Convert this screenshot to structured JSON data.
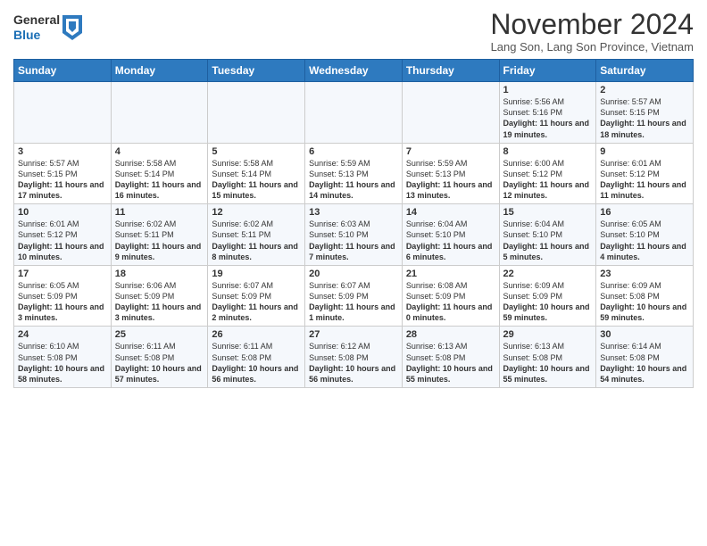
{
  "header": {
    "logo_general": "General",
    "logo_blue": "Blue",
    "month_title": "November 2024",
    "subtitle": "Lang Son, Lang Son Province, Vietnam"
  },
  "weekdays": [
    "Sunday",
    "Monday",
    "Tuesday",
    "Wednesday",
    "Thursday",
    "Friday",
    "Saturday"
  ],
  "weeks": [
    [
      {
        "day": "",
        "info": ""
      },
      {
        "day": "",
        "info": ""
      },
      {
        "day": "",
        "info": ""
      },
      {
        "day": "",
        "info": ""
      },
      {
        "day": "",
        "info": ""
      },
      {
        "day": "1",
        "info": "Sunrise: 5:56 AM\nSunset: 5:16 PM\nDaylight: 11 hours and 19 minutes."
      },
      {
        "day": "2",
        "info": "Sunrise: 5:57 AM\nSunset: 5:15 PM\nDaylight: 11 hours and 18 minutes."
      }
    ],
    [
      {
        "day": "3",
        "info": "Sunrise: 5:57 AM\nSunset: 5:15 PM\nDaylight: 11 hours and 17 minutes."
      },
      {
        "day": "4",
        "info": "Sunrise: 5:58 AM\nSunset: 5:14 PM\nDaylight: 11 hours and 16 minutes."
      },
      {
        "day": "5",
        "info": "Sunrise: 5:58 AM\nSunset: 5:14 PM\nDaylight: 11 hours and 15 minutes."
      },
      {
        "day": "6",
        "info": "Sunrise: 5:59 AM\nSunset: 5:13 PM\nDaylight: 11 hours and 14 minutes."
      },
      {
        "day": "7",
        "info": "Sunrise: 5:59 AM\nSunset: 5:13 PM\nDaylight: 11 hours and 13 minutes."
      },
      {
        "day": "8",
        "info": "Sunrise: 6:00 AM\nSunset: 5:12 PM\nDaylight: 11 hours and 12 minutes."
      },
      {
        "day": "9",
        "info": "Sunrise: 6:01 AM\nSunset: 5:12 PM\nDaylight: 11 hours and 11 minutes."
      }
    ],
    [
      {
        "day": "10",
        "info": "Sunrise: 6:01 AM\nSunset: 5:12 PM\nDaylight: 11 hours and 10 minutes."
      },
      {
        "day": "11",
        "info": "Sunrise: 6:02 AM\nSunset: 5:11 PM\nDaylight: 11 hours and 9 minutes."
      },
      {
        "day": "12",
        "info": "Sunrise: 6:02 AM\nSunset: 5:11 PM\nDaylight: 11 hours and 8 minutes."
      },
      {
        "day": "13",
        "info": "Sunrise: 6:03 AM\nSunset: 5:10 PM\nDaylight: 11 hours and 7 minutes."
      },
      {
        "day": "14",
        "info": "Sunrise: 6:04 AM\nSunset: 5:10 PM\nDaylight: 11 hours and 6 minutes."
      },
      {
        "day": "15",
        "info": "Sunrise: 6:04 AM\nSunset: 5:10 PM\nDaylight: 11 hours and 5 minutes."
      },
      {
        "day": "16",
        "info": "Sunrise: 6:05 AM\nSunset: 5:10 PM\nDaylight: 11 hours and 4 minutes."
      }
    ],
    [
      {
        "day": "17",
        "info": "Sunrise: 6:05 AM\nSunset: 5:09 PM\nDaylight: 11 hours and 3 minutes."
      },
      {
        "day": "18",
        "info": "Sunrise: 6:06 AM\nSunset: 5:09 PM\nDaylight: 11 hours and 3 minutes."
      },
      {
        "day": "19",
        "info": "Sunrise: 6:07 AM\nSunset: 5:09 PM\nDaylight: 11 hours and 2 minutes."
      },
      {
        "day": "20",
        "info": "Sunrise: 6:07 AM\nSunset: 5:09 PM\nDaylight: 11 hours and 1 minute."
      },
      {
        "day": "21",
        "info": "Sunrise: 6:08 AM\nSunset: 5:09 PM\nDaylight: 11 hours and 0 minutes."
      },
      {
        "day": "22",
        "info": "Sunrise: 6:09 AM\nSunset: 5:09 PM\nDaylight: 10 hours and 59 minutes."
      },
      {
        "day": "23",
        "info": "Sunrise: 6:09 AM\nSunset: 5:08 PM\nDaylight: 10 hours and 59 minutes."
      }
    ],
    [
      {
        "day": "24",
        "info": "Sunrise: 6:10 AM\nSunset: 5:08 PM\nDaylight: 10 hours and 58 minutes."
      },
      {
        "day": "25",
        "info": "Sunrise: 6:11 AM\nSunset: 5:08 PM\nDaylight: 10 hours and 57 minutes."
      },
      {
        "day": "26",
        "info": "Sunrise: 6:11 AM\nSunset: 5:08 PM\nDaylight: 10 hours and 56 minutes."
      },
      {
        "day": "27",
        "info": "Sunrise: 6:12 AM\nSunset: 5:08 PM\nDaylight: 10 hours and 56 minutes."
      },
      {
        "day": "28",
        "info": "Sunrise: 6:13 AM\nSunset: 5:08 PM\nDaylight: 10 hours and 55 minutes."
      },
      {
        "day": "29",
        "info": "Sunrise: 6:13 AM\nSunset: 5:08 PM\nDaylight: 10 hours and 55 minutes."
      },
      {
        "day": "30",
        "info": "Sunrise: 6:14 AM\nSunset: 5:08 PM\nDaylight: 10 hours and 54 minutes."
      }
    ]
  ]
}
